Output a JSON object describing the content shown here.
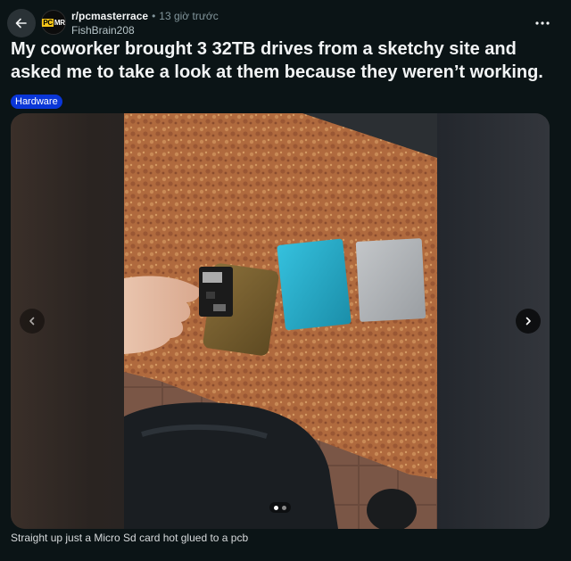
{
  "header": {
    "subreddit": "r/pcmasterrace",
    "separator": "•",
    "time": "13 giờ trước",
    "author": "FishBrain208",
    "avatar_logo": "PCMR"
  },
  "post": {
    "title": "My coworker brought 3 32TB drives from a sketchy site and asked me to take a look at them because they weren’t working.",
    "flair": "Hardware",
    "flair_color": "#0a36d8"
  },
  "gallery": {
    "image_count": 2,
    "current_index": 1,
    "caption": "Straight up just a Micro Sd card hot glued to a pcb"
  },
  "icons": {
    "back": "arrow-left-icon",
    "more": "ellipsis-icon",
    "prev": "chevron-left-icon",
    "next": "chevron-right-icon"
  }
}
